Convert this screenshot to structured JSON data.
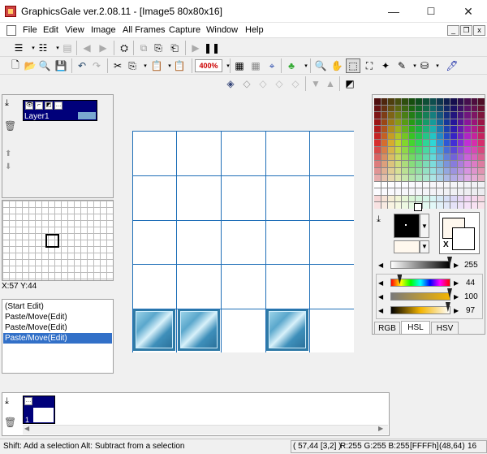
{
  "window": {
    "title": "GraphicsGale ver.2.08.11 - [Image5 80x80x16]",
    "minimize": "—",
    "maximize": "☐",
    "close": "✕"
  },
  "menu": {
    "items": [
      "File",
      "Edit",
      "View",
      "Image",
      "All Frames",
      "Capture",
      "Window",
      "Help"
    ]
  },
  "mdi_controls": [
    "_",
    "❐",
    "x"
  ],
  "toolbar": {
    "zoom_value": "400%"
  },
  "layers": {
    "layer_name": "Layer1"
  },
  "preview": {
    "coords": "X:57 Y:44"
  },
  "history": {
    "items": [
      "(Start Edit)",
      "Paste/Move(Edit)",
      "Paste/Move(Edit)",
      "Paste/Move(Edit)"
    ],
    "selected_index": 3
  },
  "color": {
    "sliders": [
      {
        "name": "value",
        "value": "255",
        "fraction": 1.0
      },
      {
        "name": "hue",
        "value": "44",
        "fraction": 0.12
      },
      {
        "name": "saturation",
        "value": "100",
        "fraction": 1.0
      },
      {
        "name": "lightness",
        "value": "97",
        "fraction": 0.97
      }
    ],
    "tabs": [
      "RGB",
      "HSL",
      "HSV"
    ],
    "active_tab": "HSL",
    "swap_label": "X",
    "foreground": "#000000",
    "background": "#fff8ee"
  },
  "status": {
    "hint": "Shift: Add a selection  Alt: Subtract from a selection",
    "cursor": "( 57,44 [3,2] )",
    "rgb": "R:255 G:255 B:255",
    "hex": "[FFFFh]",
    "size": "(48,64)",
    "depth": "16"
  }
}
